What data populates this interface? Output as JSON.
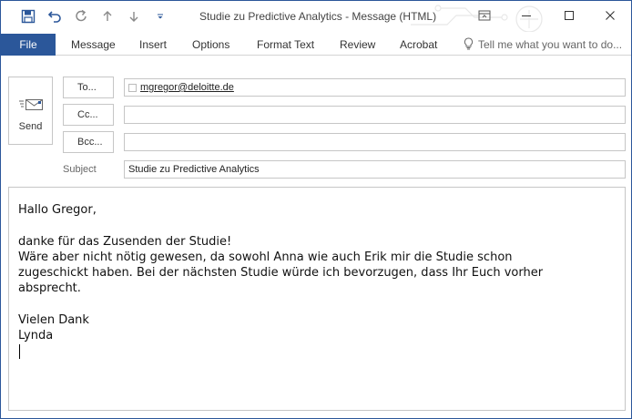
{
  "window": {
    "title": "Studie zu Predictive Analytics - Message (HTML)"
  },
  "ribbon": {
    "file": "File",
    "tabs": [
      "Message",
      "Insert",
      "Options",
      "Format Text",
      "Review",
      "Acrobat"
    ],
    "tell_me_placeholder": "Tell me what you want to do..."
  },
  "compose": {
    "send_label": "Send",
    "to_label": "To...",
    "cc_label": "Cc...",
    "bcc_label": "Bcc...",
    "to_recipient": "mgregor@deloitte.de",
    "cc_value": "",
    "bcc_value": "",
    "subject_label": "Subject",
    "subject_value": "Studie zu Predictive Analytics"
  },
  "body": {
    "lines": [
      "Hallo Gregor,",
      "",
      "danke für das Zusenden der Studie!",
      "Wäre aber nicht nötig gewesen, da sowohl Anna wie auch Erik mir die Studie schon",
      "zugeschickt haben. Bei der nächsten Studie würde ich bevorzugen, dass Ihr Euch vorher",
      "absprecht.",
      "",
      "Vielen Dank",
      "Lynda"
    ]
  },
  "colors": {
    "accent": "#2b579a"
  },
  "icons": {
    "save": "save-icon",
    "undo": "undo-icon",
    "redo": "redo-icon",
    "up": "arrow-up-icon",
    "down": "arrow-down-icon",
    "customize": "customize-qat-icon",
    "ribbon_display": "ribbon-display-icon",
    "minimize": "minimize-icon",
    "maximize": "maximize-icon",
    "close": "close-icon",
    "lightbulb": "lightbulb-icon",
    "send": "send-envelope-icon"
  }
}
